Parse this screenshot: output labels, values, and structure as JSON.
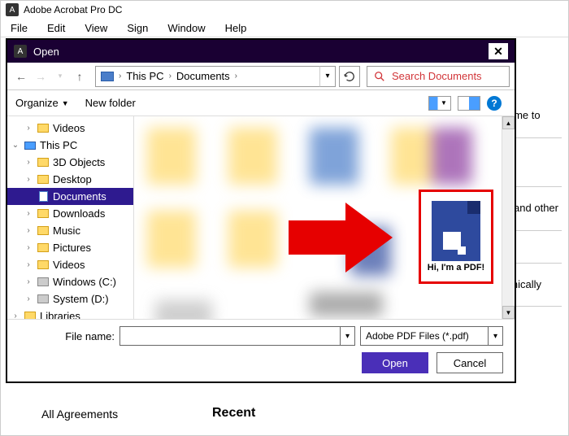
{
  "app": {
    "title": "Adobe Acrobat Pro DC"
  },
  "menu": {
    "file": "File",
    "edit": "Edit",
    "view": "View",
    "sign": "Sign",
    "window": "Window",
    "help": "Help"
  },
  "dialog": {
    "title": "Open",
    "breadcrumb": {
      "root": "This PC",
      "folder": "Documents"
    },
    "search_placeholder": "Search Documents",
    "organize": "Organize",
    "new_folder": "New folder",
    "filename_label": "File name:",
    "filename_value": "",
    "filter": "Adobe PDF Files (*.pdf)",
    "open_btn": "Open",
    "cancel_btn": "Cancel"
  },
  "tree": [
    {
      "label": "Videos",
      "indent": 1,
      "chev": "›",
      "icon": "folder"
    },
    {
      "label": "This PC",
      "indent": 0,
      "chev": "⌄",
      "icon": "pc"
    },
    {
      "label": "3D Objects",
      "indent": 1,
      "chev": "›",
      "icon": "folder"
    },
    {
      "label": "Desktop",
      "indent": 1,
      "chev": "›",
      "icon": "folder"
    },
    {
      "label": "Documents",
      "indent": 1,
      "chev": "",
      "icon": "doc",
      "selected": true
    },
    {
      "label": "Downloads",
      "indent": 1,
      "chev": "›",
      "icon": "folder"
    },
    {
      "label": "Music",
      "indent": 1,
      "chev": "›",
      "icon": "folder"
    },
    {
      "label": "Pictures",
      "indent": 1,
      "chev": "›",
      "icon": "folder"
    },
    {
      "label": "Videos",
      "indent": 1,
      "chev": "›",
      "icon": "folder"
    },
    {
      "label": "Windows (C:)",
      "indent": 1,
      "chev": "›",
      "icon": "drive"
    },
    {
      "label": "System (D:)",
      "indent": 1,
      "chev": "›",
      "icon": "drive"
    },
    {
      "label": "Libraries",
      "indent": 0,
      "chev": "›",
      "icon": "lib"
    }
  ],
  "highlighted_file": {
    "label": "Hi, I'm a PDF!"
  },
  "bg": {
    "welcome": "elcome to",
    "fice": "fice and other",
    "ctron": "ctronically",
    "agreements": "All Agreements",
    "recent": "Recent"
  }
}
